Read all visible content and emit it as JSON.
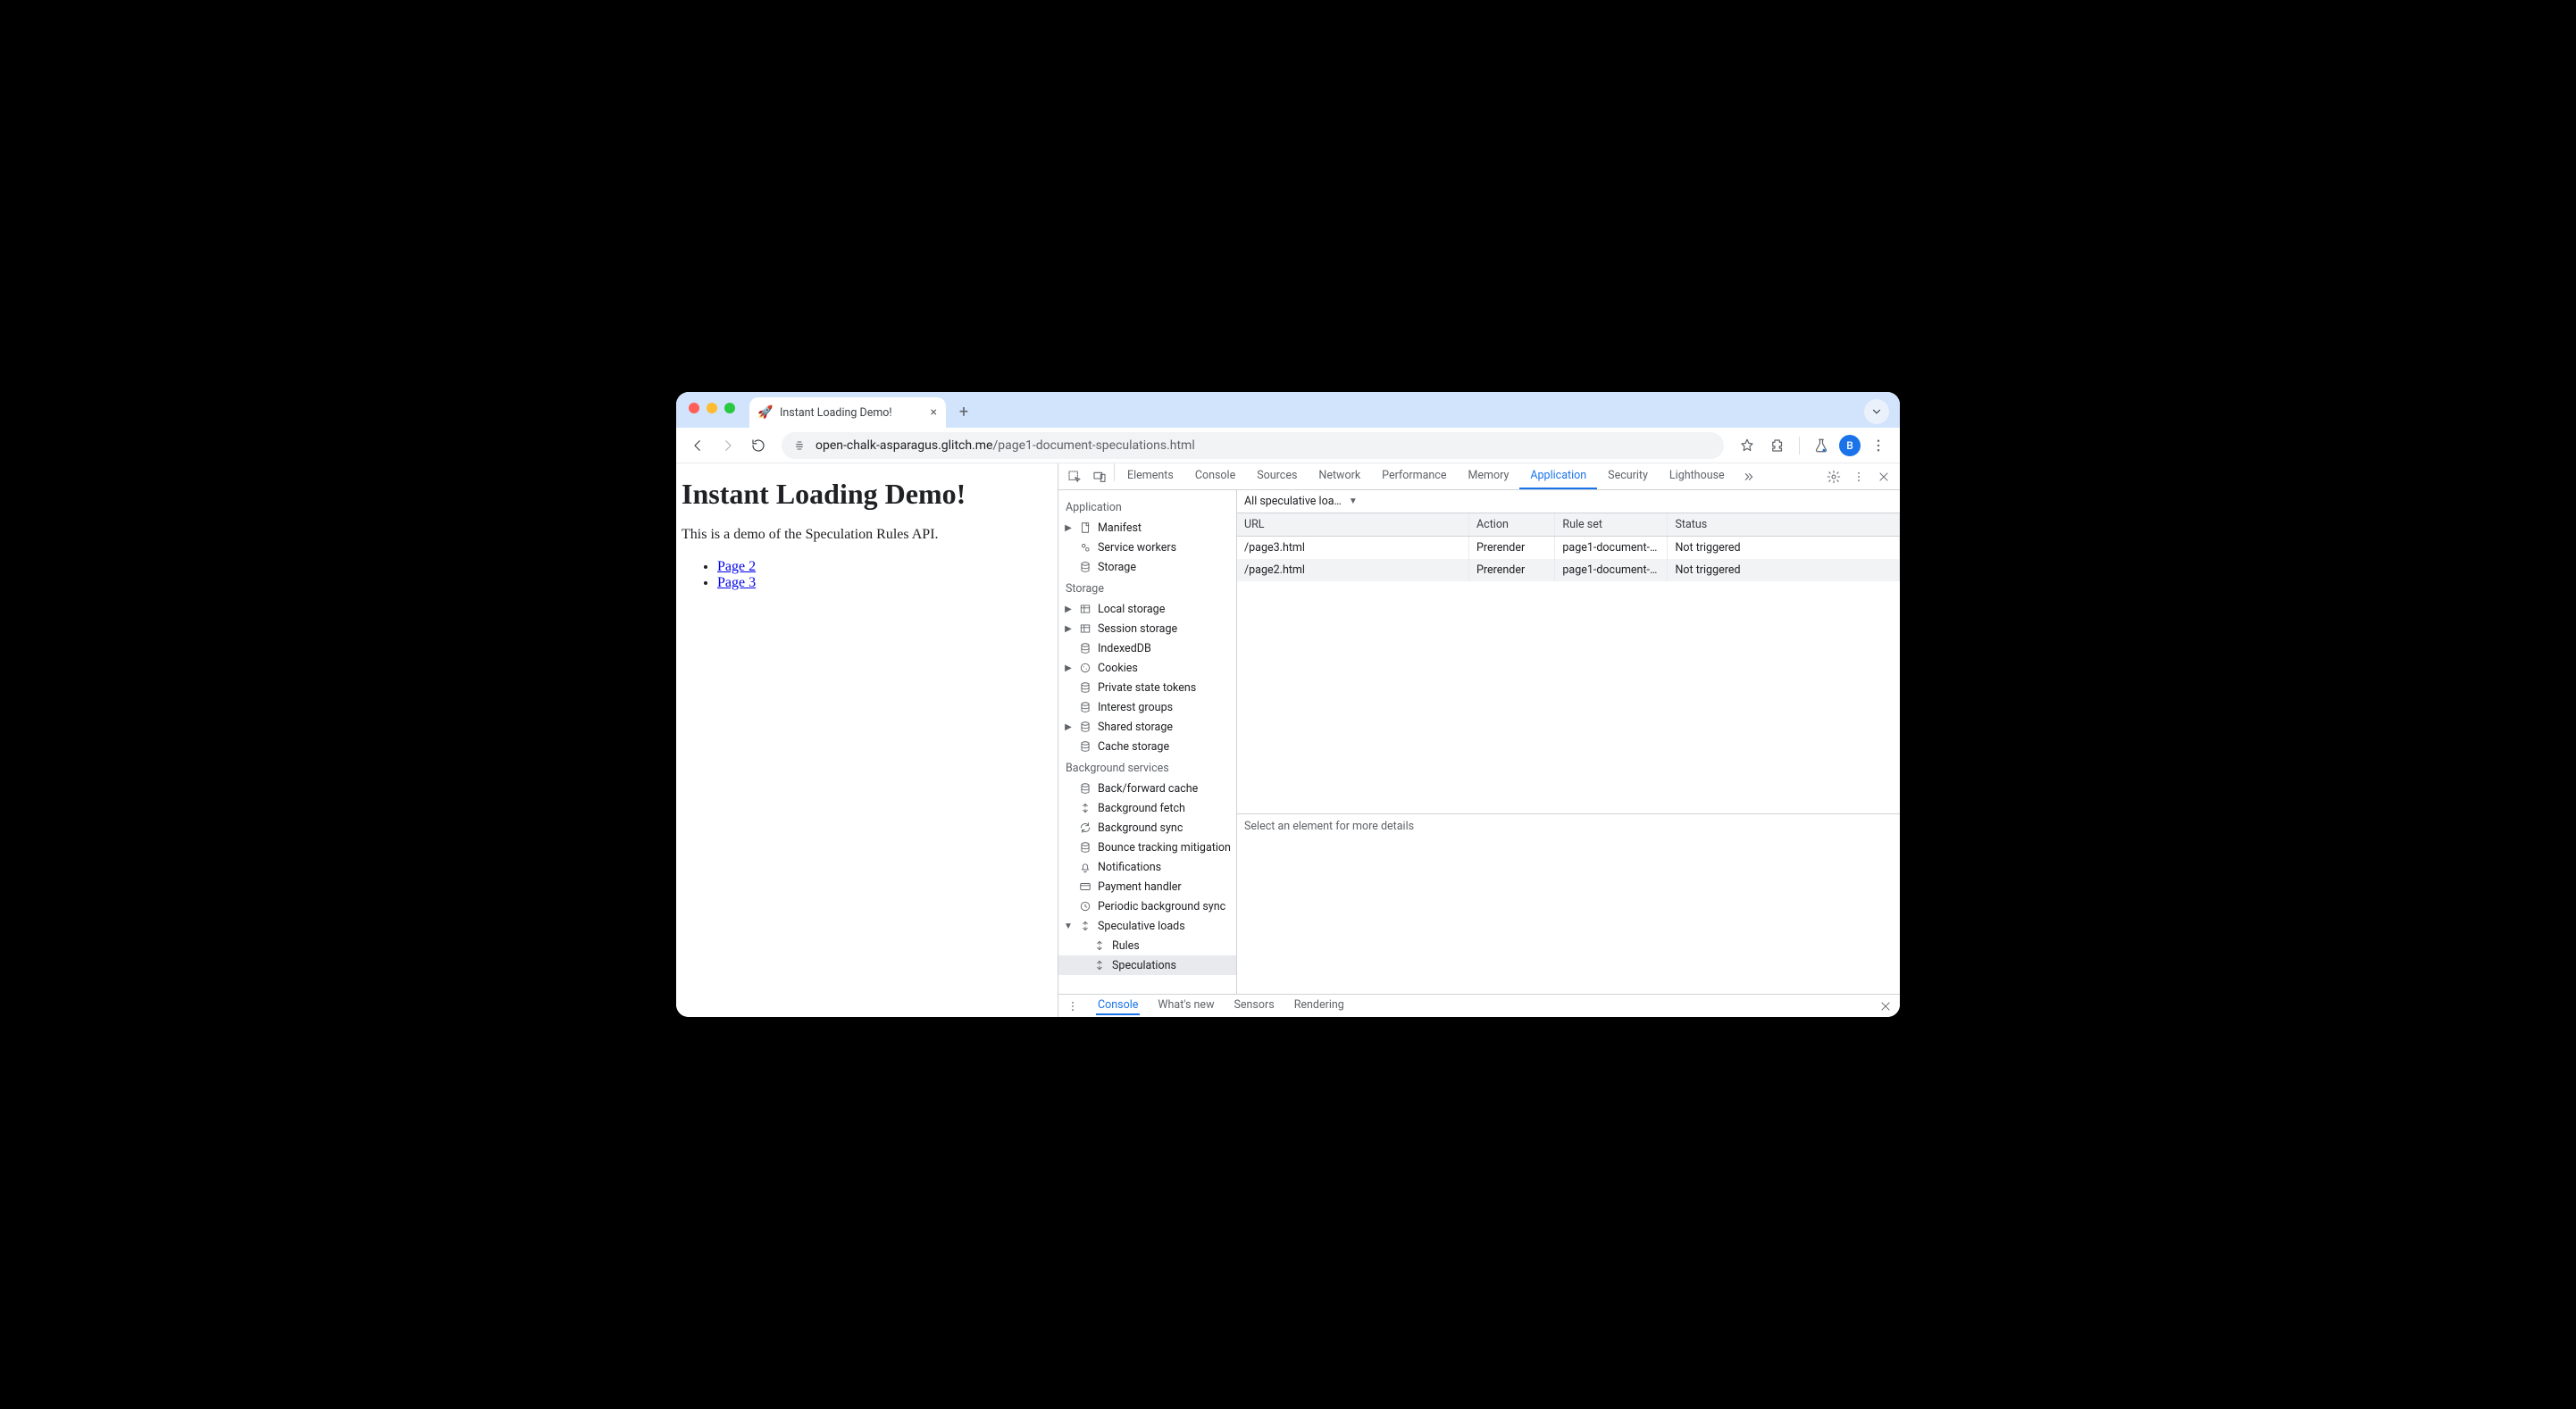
{
  "tab": {
    "title": "Instant Loading Demo!",
    "favicon": "🚀"
  },
  "url": {
    "domain": "open-chalk-asparagus.glitch.me",
    "path": "/page1-document-speculations.html"
  },
  "avatar_letter": "B",
  "page": {
    "heading": "Instant Loading Demo!",
    "paragraph": "This is a demo of the Speculation Rules API.",
    "links": [
      {
        "label": "Page 2"
      },
      {
        "label": "Page 3"
      }
    ]
  },
  "devtools": {
    "tabs": [
      "Elements",
      "Console",
      "Sources",
      "Network",
      "Performance",
      "Memory",
      "Application",
      "Security",
      "Lighthouse"
    ],
    "active_tab": "Application",
    "sidebar": {
      "groups": [
        {
          "title": "Application",
          "items": [
            {
              "label": "Manifest",
              "icon": "file",
              "expandable": true
            },
            {
              "label": "Service workers",
              "icon": "gears"
            },
            {
              "label": "Storage",
              "icon": "db"
            }
          ]
        },
        {
          "title": "Storage",
          "items": [
            {
              "label": "Local storage",
              "icon": "table",
              "expandable": true
            },
            {
              "label": "Session storage",
              "icon": "table",
              "expandable": true
            },
            {
              "label": "IndexedDB",
              "icon": "db"
            },
            {
              "label": "Cookies",
              "icon": "cookie",
              "expandable": true
            },
            {
              "label": "Private state tokens",
              "icon": "db"
            },
            {
              "label": "Interest groups",
              "icon": "db"
            },
            {
              "label": "Shared storage",
              "icon": "db",
              "expandable": true
            },
            {
              "label": "Cache storage",
              "icon": "db"
            }
          ]
        },
        {
          "title": "Background services",
          "items": [
            {
              "label": "Back/forward cache",
              "icon": "db"
            },
            {
              "label": "Background fetch",
              "icon": "sync"
            },
            {
              "label": "Background sync",
              "icon": "refresh"
            },
            {
              "label": "Bounce tracking mitigation",
              "icon": "db"
            },
            {
              "label": "Notifications",
              "icon": "bell"
            },
            {
              "label": "Payment handler",
              "icon": "card"
            },
            {
              "label": "Periodic background sync",
              "icon": "clock"
            },
            {
              "label": "Speculative loads",
              "icon": "sync",
              "expandable": true,
              "expanded": true,
              "children": [
                {
                  "label": "Rules",
                  "icon": "sync"
                },
                {
                  "label": "Speculations",
                  "icon": "sync",
                  "selected": true
                }
              ]
            }
          ]
        }
      ]
    },
    "filter_label": "All speculative loa…",
    "table": {
      "cols": [
        "URL",
        "Action",
        "Rule set",
        "Status"
      ],
      "rows": [
        {
          "url": "/page3.html",
          "action": "Prerender",
          "ruleset": "page1-document-…",
          "status": "Not triggered"
        },
        {
          "url": "/page2.html",
          "action": "Prerender",
          "ruleset": "page1-document-…",
          "status": "Not triggered"
        }
      ]
    },
    "detail_placeholder": "Select an element for more details",
    "drawer": {
      "tabs": [
        "Console",
        "What's new",
        "Sensors",
        "Rendering"
      ],
      "active": "Console"
    }
  }
}
